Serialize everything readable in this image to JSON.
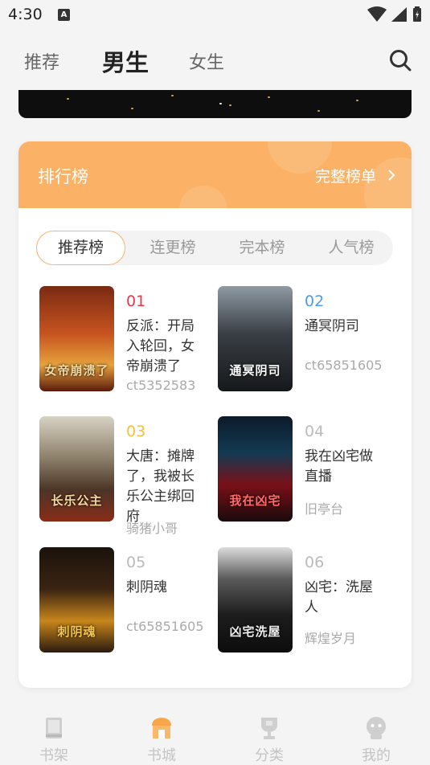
{
  "status": {
    "time": "4:30"
  },
  "header": {
    "tabs": [
      {
        "label": "推荐",
        "active": false
      },
      {
        "label": "男生",
        "active": true
      },
      {
        "label": "女生",
        "active": false
      }
    ]
  },
  "ranking": {
    "title": "排行榜",
    "more_label": "完整榜单",
    "tabs": [
      "推荐榜",
      "连更榜",
      "完本榜",
      "人气榜"
    ],
    "books": [
      {
        "rank": "01",
        "rank_color": "#e9384a",
        "name": "反派：开局入轮回，女帝崩溃了",
        "author": "ct5352583",
        "cover_title": "女帝崩溃了"
      },
      {
        "rank": "02",
        "rank_color": "#4f9be2",
        "name": "通冥阴司",
        "author": "ct65851605",
        "cover_title": "通冥阴司"
      },
      {
        "rank": "03",
        "rank_color": "#f7bf3a",
        "name": "大唐：摊牌了，我被长乐公主绑回府",
        "author": "骑猪小哥",
        "cover_title": "长乐公主"
      },
      {
        "rank": "04",
        "rank_color": "#bbbbbb",
        "name": "我在凶宅做直播",
        "author": "旧亭台",
        "cover_title": "我在凶宅"
      },
      {
        "rank": "05",
        "rank_color": "#bbbbbb",
        "name": "刺阴魂",
        "author": "ct65851605",
        "cover_title": "刺阴魂"
      },
      {
        "rank": "06",
        "rank_color": "#bbbbbb",
        "name": "凶宅：洗屋人",
        "author": "辉煌岁月",
        "cover_title": "凶宅洗屋"
      }
    ]
  },
  "nav": [
    {
      "label": "书架",
      "icon": "bookshelf-icon",
      "active": false
    },
    {
      "label": "书城",
      "icon": "bookstore-icon",
      "active": true
    },
    {
      "label": "分类",
      "icon": "category-icon",
      "active": false
    },
    {
      "label": "我的",
      "icon": "profile-icon",
      "active": false
    }
  ],
  "colors": {
    "accent": "#f8a64a",
    "rank_header": "#fbb266"
  }
}
